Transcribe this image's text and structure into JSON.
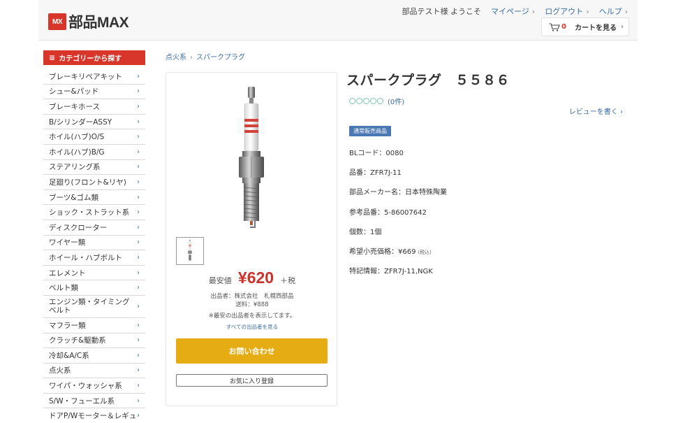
{
  "header": {
    "logo_mark": "MX",
    "logo_text": "部品MAX",
    "welcome": "部品テスト様 ようこそ",
    "nav": [
      {
        "label": "マイページ"
      },
      {
        "label": "ログアウト"
      },
      {
        "label": "ヘルプ"
      }
    ],
    "cart_count": "0",
    "cart_label": "カートを見る"
  },
  "sidebar": {
    "title": "カテゴリーから探す",
    "items": [
      "ブレーキリペアキット",
      "シュー&パッド",
      "ブレーキホース",
      "B/シリンダーASSY",
      "ホイル(ハブ)O/S",
      "ホイル(ハブ)B/G",
      "ステアリング系",
      "足廻り(フロント&リヤ)",
      "ブーツ&ゴム類",
      "ショック・ストラット系",
      "ディスクローター",
      "ワイヤー類",
      "ホイール・ハブボルト",
      "エレメント",
      "ベルト類",
      "エンジン類・タイミングベルト",
      "マフラー類",
      "クラッチ&駆動系",
      "冷却&A/C系",
      "点火系",
      "ワイパ・ウォッシャ系",
      "S/W・フューエル系",
      "ドアP/Wモーター＆レギュ"
    ]
  },
  "breadcrumb": [
    "点火系",
    "スパークプラグ"
  ],
  "product": {
    "title": "スパークプラグ　５５８６",
    "review_count": "(0件)",
    "write_review": "レビューを書く",
    "badge": "通常販売商品",
    "specs": [
      "BLコード：0080",
      "品番：ZFR7J-11",
      "部品メーカー名：日本特殊陶業",
      "参考品番：5-86007642",
      "個数：1個",
      "希望小売価格：¥669",
      "特記情報：ZFR7J-11,NGK"
    ],
    "tax_note": "(税込)"
  },
  "card": {
    "price_label": "最安値",
    "price": "¥620",
    "price_tax": "＋税",
    "seller": "出品者：株式会社　札幌西部品",
    "shipping": "送料：¥888",
    "lowest_note": "※最安の出品者を表示してます。",
    "all_sellers": "すべての出品者を見る",
    "inquiry_button": "お問い合わせ",
    "favorite_button": "お気に入り登録"
  },
  "colors": {
    "brand_red": "#d8362a",
    "link_blue": "#3a6ea5",
    "inquiry_yellow": "#e6ac13",
    "badge_blue": "#4a78b3"
  }
}
